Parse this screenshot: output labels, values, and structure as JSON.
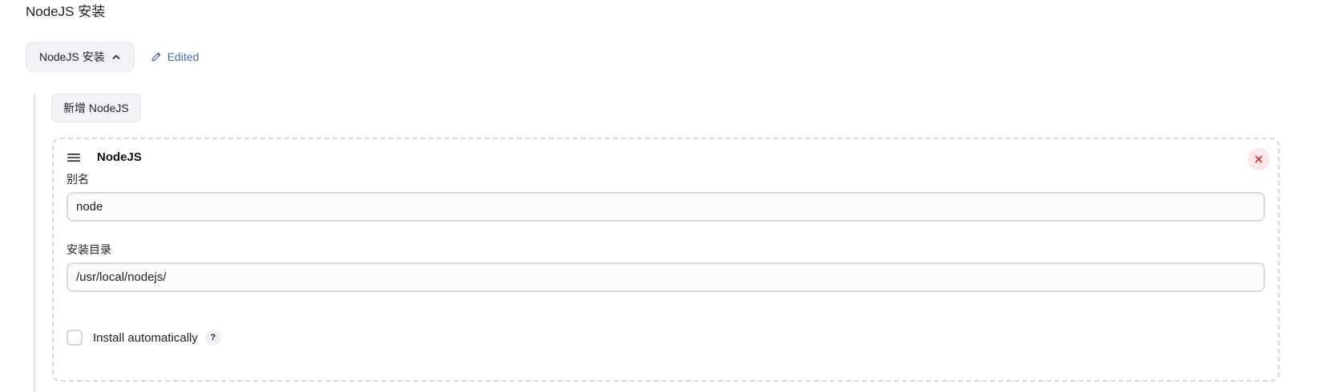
{
  "section": {
    "title": "NodeJS 安装"
  },
  "toggle": {
    "label": "NodeJS 安装",
    "edited_label": "Edited"
  },
  "add_button": {
    "label": "新增 NodeJS"
  },
  "installation": {
    "title": "NodeJS",
    "alias": {
      "label": "别名",
      "value": "node"
    },
    "install_dir": {
      "label": "安装目录",
      "value": "/usr/local/nodejs/"
    },
    "auto_install": {
      "label": "Install automatically",
      "checked": false,
      "help": "?"
    }
  },
  "icons": {
    "toggle": "chevron-up-icon",
    "edited": "pencil-icon",
    "drag": "drag-handle-icon",
    "delete": "close-icon"
  },
  "colors": {
    "edited_text": "#4b6aa3",
    "delete_bg": "#fde7ea",
    "delete_icon": "#d6233a"
  }
}
